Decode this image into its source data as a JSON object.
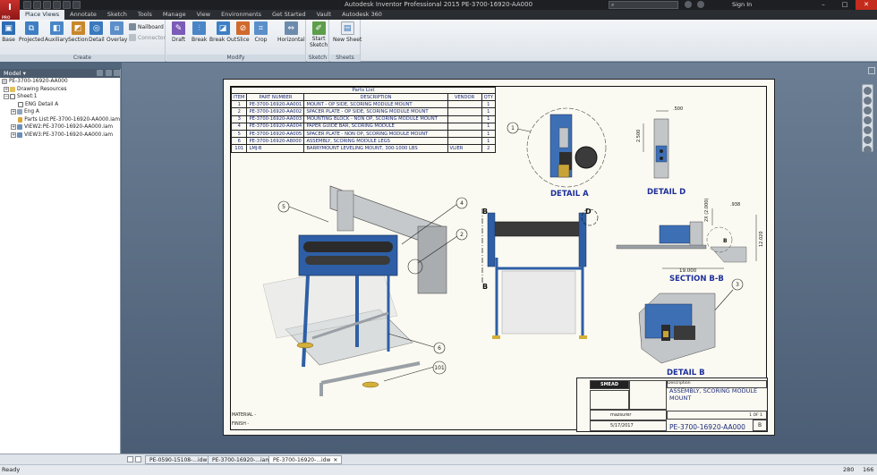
{
  "titlebar": {
    "logo_text": "I",
    "edition": "PRO",
    "title": "Autodesk Inventor Professional 2015    PE-3700-16920-AA000",
    "search_placeholder": "",
    "sign_in": "Sign In"
  },
  "ribbon_tabs": [
    "Place Views",
    "Annotate",
    "Sketch",
    "Tools",
    "Manage",
    "View",
    "Environments",
    "Get Started",
    "Vault",
    "Autodesk 360"
  ],
  "ribbon": {
    "create": {
      "label": "Create",
      "buttons": [
        "Base",
        "Projected",
        "Auxiliary",
        "Section",
        "Detail",
        "Overlay"
      ],
      "nailboard": "Nailboard",
      "connector": "Connector"
    },
    "modify": {
      "label": "Modify",
      "buttons": [
        "Draft",
        "Break",
        "Break Out",
        "Slice",
        "Crop",
        "Horizontal"
      ]
    },
    "sketch": {
      "label": "Sketch",
      "button_line1": "Start",
      "button_line2": "Sketch"
    },
    "sheets": {
      "label": "Sheets",
      "button": "New Sheet"
    }
  },
  "browser": {
    "title": "Model",
    "items": [
      "PE-3700-16920-AA000",
      "Drawing Resources",
      "Sheet:1",
      "ENG Detail A",
      "Eng A",
      "Parts List:PE-3700-16920-AA000.iam",
      "VIEW2:PE-3700-16920-AA000.iam",
      "VIEW3:PE-3700-16920-AA000.iam"
    ]
  },
  "parts_list": {
    "title": "Parts List",
    "headers": [
      "ITEM",
      "PART NUMBER",
      "DESCRIPTION",
      "VENDOR",
      "QTY"
    ],
    "rows": [
      [
        "1",
        "PE-3700-16920-AA001",
        "MOUNT - OP SIDE, SCORING MODULE MOUNT",
        "",
        "1"
      ],
      [
        "2",
        "PE-3700-16920-AA002",
        "SPACER PLATE - OP SIDE, SCORING MODULE MOUNT",
        "",
        "1"
      ],
      [
        "3",
        "PE-3700-16920-AA003",
        "MOUNTING BLOCK - NON OP, SCORING MODULE MOUNT",
        "",
        "1"
      ],
      [
        "4",
        "PE-3700-16920-AA004",
        "PAPER GUIDE BAR, SCORING MODULE",
        "",
        "1"
      ],
      [
        "5",
        "PE-3700-16920-AA005",
        "SPACER PLATE - NON OP, SCORING MODULE MOUNT",
        "",
        "1"
      ],
      [
        "6",
        "PE-3700-16920-A8000",
        "ASSEMBLY, SCORING MODULE LEGS",
        "",
        "1"
      ],
      [
        "101",
        "LMJ-B",
        "BARRYMOUNT LEVELING MOUNT, 300-1000 LBS",
        "VLIER",
        "2"
      ]
    ]
  },
  "views": {
    "detail_a": "DETAIL  A",
    "detail_d": "DETAIL  D",
    "section_bb": "SECTION B-B",
    "detail_b": "DETAIL  B",
    "section_marker": "B",
    "detail_marker": "D",
    "balloons": [
      "5",
      "4",
      "2",
      "6",
      "101",
      "1",
      "3"
    ],
    "dims": [
      ".500",
      "2.500",
      "2X (2.000)",
      ".938",
      "12.020",
      "19.000"
    ]
  },
  "title_block": {
    "company": "SMEAD",
    "description_label": "Description",
    "description": "ASSEMBLY, SCORING MODULE MOUNT",
    "part_number": "PE-3700-16920-AA000",
    "drawn_by": "mazsurer",
    "date": "5/17/2017",
    "sheet": "1 OF 1",
    "rev": "B",
    "material": "MATERIAL -",
    "finish": "FINISH -"
  },
  "doc_tabs": [
    "PE-0590-15108-...idw",
    "PE-3700-16920-...iam",
    "PE-3700-16920-...idw"
  ],
  "status": {
    "text": "Ready",
    "x": "280",
    "y": "166"
  },
  "colors": {
    "accent": "#2e6db4",
    "ribbon_bg": "#e9edf2",
    "sheet": "#fbfaf2",
    "canvas": "#5a6e86",
    "drawing_ink": "#1e2f9a"
  }
}
